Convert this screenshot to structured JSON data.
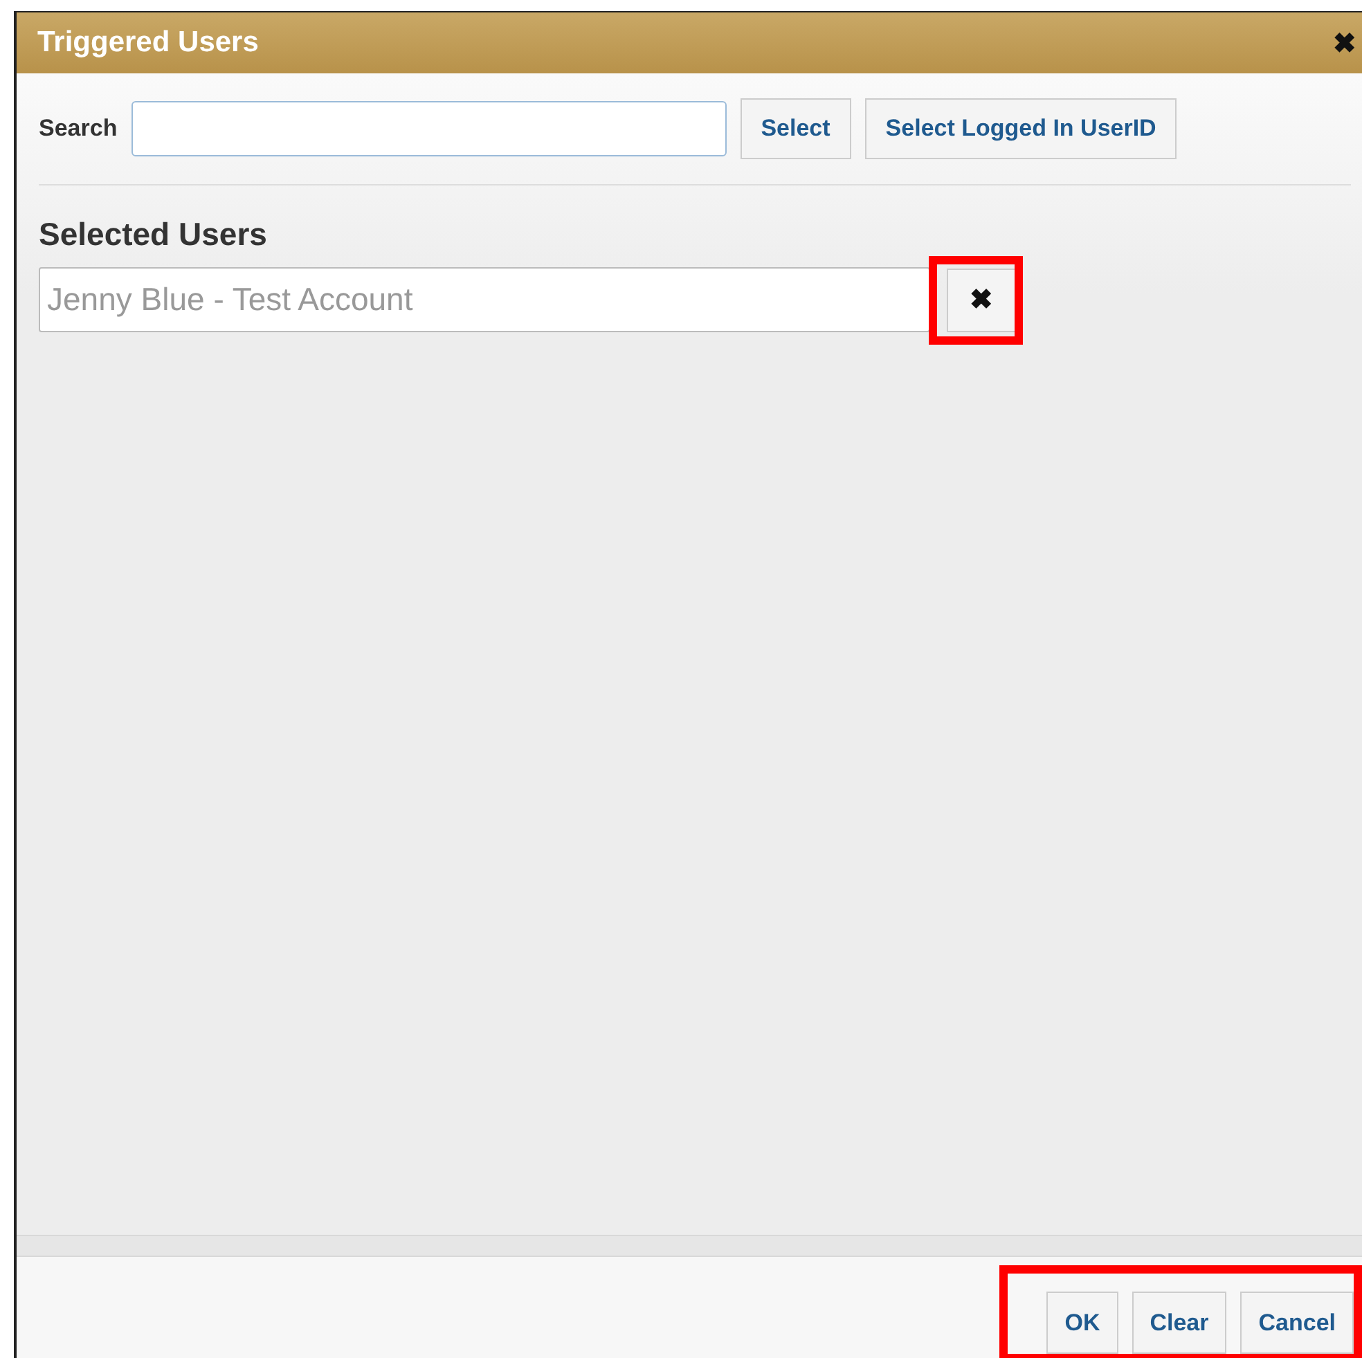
{
  "window": {
    "title": "Triggered Users",
    "close": "✖"
  },
  "search": {
    "label": "Search",
    "buttons": [
      "Select",
      "Select Logged In UserID"
    ]
  },
  "selected_users": {
    "heading": "Selected Users",
    "items": [
      {
        "name": "Jenny Blue - Test Account",
        "disabled": true,
        "remove": "✖",
        "highlighted": true
      }
    ]
  },
  "footer": {
    "highlighted": true,
    "buttons": [
      "OK",
      "Clear",
      "Cancel"
    ]
  }
}
